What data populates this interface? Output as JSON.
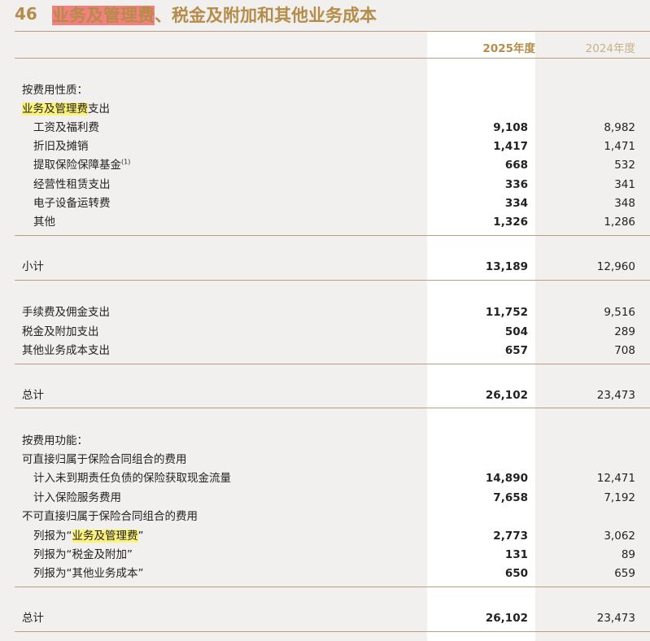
{
  "title": {
    "number": "46",
    "highlight": "业务及管理费",
    "rest": "、税金及附加和其他业务成本"
  },
  "headers": {
    "y2025": "2025年度",
    "y2024": "2024年度"
  },
  "section1": {
    "heading": "按费用性质：",
    "group_label_hl": "业务及管理费",
    "group_label_rest": "支出",
    "items": [
      {
        "label": "工资及福利费",
        "v2025": "9,108",
        "v2024": "8,982"
      },
      {
        "label": "折旧及摊销",
        "v2025": "1,417",
        "v2024": "1,471"
      },
      {
        "label": "提取保险保障基金",
        "sup": "(1)",
        "v2025": "668",
        "v2024": "532"
      },
      {
        "label": "经营性租赁支出",
        "v2025": "336",
        "v2024": "341"
      },
      {
        "label": "电子设备运转费",
        "v2025": "334",
        "v2024": "348"
      },
      {
        "label": "其他",
        "v2025": "1,326",
        "v2024": "1,286"
      }
    ],
    "subtotal": {
      "label": "小计",
      "v2025": "13,189",
      "v2024": "12,960"
    },
    "others": [
      {
        "label": "手续费及佣金支出",
        "v2025": "11,752",
        "v2024": "9,516"
      },
      {
        "label": "税金及附加支出",
        "v2025": "504",
        "v2024": "289"
      },
      {
        "label": "其他业务成本支出",
        "v2025": "657",
        "v2024": "708"
      }
    ],
    "total": {
      "label": "总计",
      "v2025": "26,102",
      "v2024": "23,473"
    }
  },
  "section2": {
    "heading": "按费用功能：",
    "group1": "可直接归属于保险合同组合的费用",
    "group1_items": [
      {
        "label": "计入未到期责任负债的保险获取现金流量",
        "v2025": "14,890",
        "v2024": "12,471"
      },
      {
        "label": "计入保险服务费用",
        "v2025": "7,658",
        "v2024": "7,192"
      }
    ],
    "group2": "不可直接归属于保险合同组合的费用",
    "group2_items": [
      {
        "label_pre": "列报为“",
        "label_hl": "业务及管理费",
        "label_post": "”",
        "v2025": "2,773",
        "v2024": "3,062"
      },
      {
        "label": "列报为“税金及附加”",
        "v2025": "131",
        "v2024": "89"
      },
      {
        "label": "列报为“其他业务成本”",
        "v2025": "650",
        "v2024": "659"
      }
    ],
    "total": {
      "label": "总计",
      "v2025": "26,102",
      "v2024": "23,473"
    }
  }
}
